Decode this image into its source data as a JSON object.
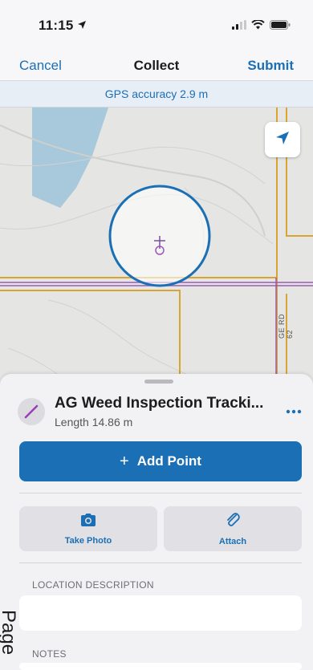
{
  "status_bar": {
    "time": "11:15"
  },
  "nav": {
    "cancel": "Cancel",
    "title": "Collect",
    "submit": "Submit"
  },
  "gps": {
    "text": "GPS accuracy 2.9 m"
  },
  "map": {
    "road_label": "GE RD 62"
  },
  "feature": {
    "title": "AG Weed Inspection Tracki...",
    "subtitle": "Length 14.86 m"
  },
  "actions": {
    "add_point": "Add Point",
    "take_photo": "Take Photo",
    "attach": "Attach"
  },
  "fields": {
    "location_description": {
      "label": "LOCATION DESCRIPTION",
      "value": ""
    },
    "notes": {
      "label": "NOTES",
      "value": ""
    }
  },
  "overlay": {
    "page_text": "Page"
  },
  "colors": {
    "accent": "#1a6fb5",
    "parcel_line": "#d9a531",
    "track_line": "#9b59b6",
    "water": "#a8c8dc"
  }
}
